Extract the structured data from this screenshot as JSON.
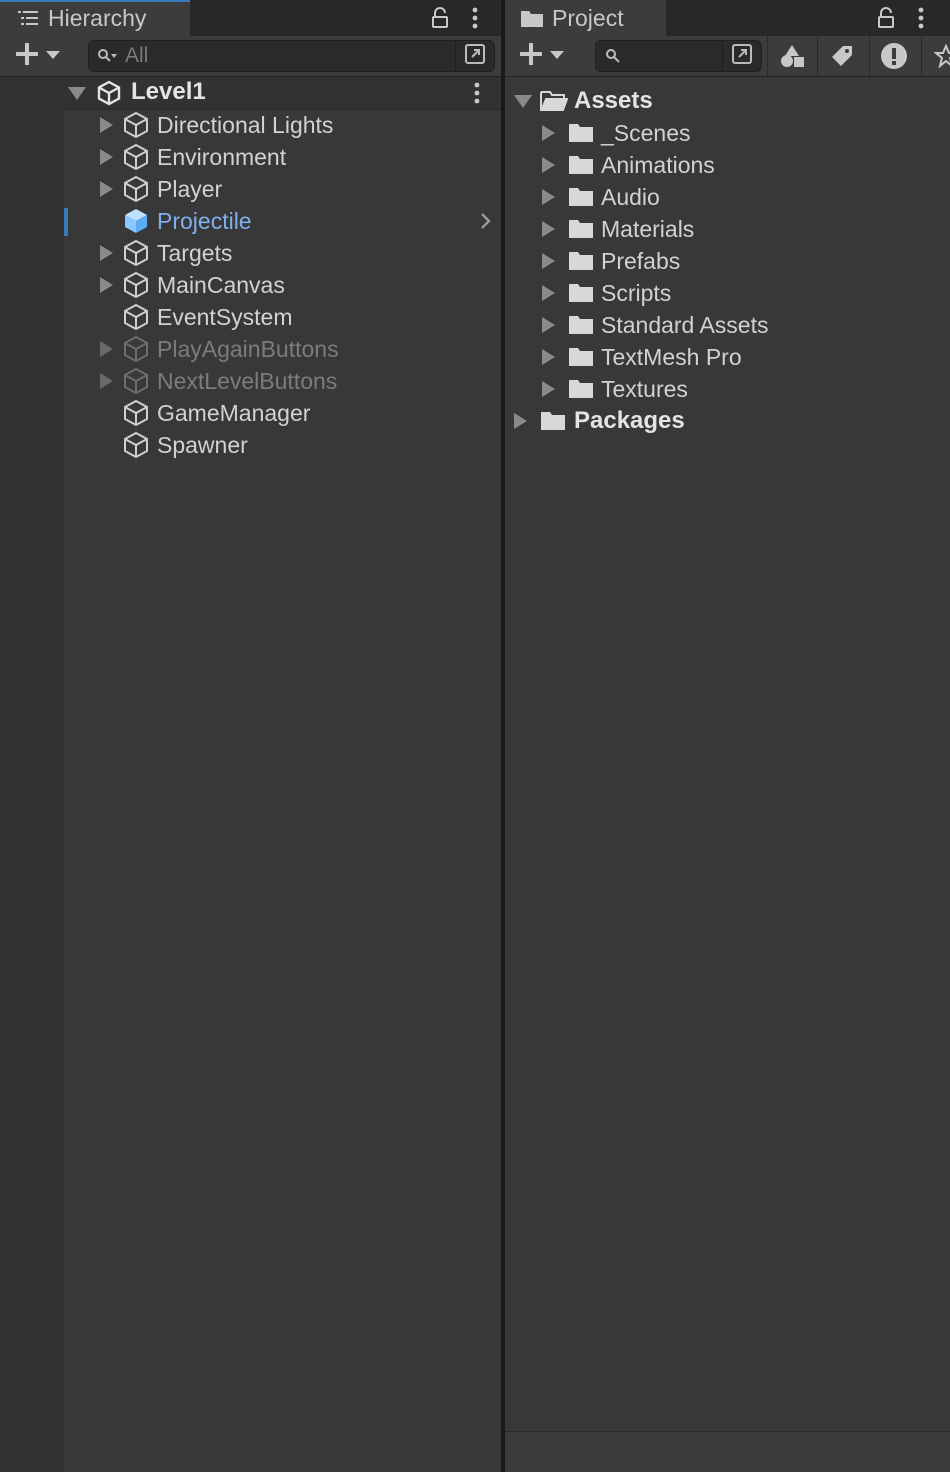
{
  "hierarchy": {
    "tab_label": "Hierarchy",
    "tab_icon": "list-icon",
    "search_placeholder": "All",
    "scene": {
      "name": "Level1",
      "icon": "unity-scene-icon",
      "expanded": true
    },
    "items": [
      {
        "name": "Directional Lights",
        "has_children": true,
        "state": "normal"
      },
      {
        "name": "Environment",
        "has_children": true,
        "state": "normal"
      },
      {
        "name": "Player",
        "has_children": true,
        "state": "normal"
      },
      {
        "name": "Projectile",
        "has_children": false,
        "state": "selected"
      },
      {
        "name": "Targets",
        "has_children": true,
        "state": "normal"
      },
      {
        "name": "MainCanvas",
        "has_children": true,
        "state": "normal"
      },
      {
        "name": "EventSystem",
        "has_children": false,
        "state": "normal"
      },
      {
        "name": "PlayAgainButtons",
        "has_children": true,
        "state": "disabled"
      },
      {
        "name": "NextLevelButtons",
        "has_children": true,
        "state": "disabled"
      },
      {
        "name": "GameManager",
        "has_children": false,
        "state": "normal"
      },
      {
        "name": "Spawner",
        "has_children": false,
        "state": "normal"
      }
    ]
  },
  "project": {
    "tab_label": "Project",
    "tab_icon": "folder-icon",
    "search_placeholder": "",
    "toolbar_icons": [
      "search-by-type-icon",
      "search-by-label-icon",
      "warning-icon",
      "favorite-icon"
    ],
    "assets": {
      "name": "Assets",
      "expanded": true,
      "children": [
        "_Scenes",
        "Animations",
        "Audio",
        "Materials",
        "Prefabs",
        "Scripts",
        "Standard Assets",
        "TextMesh Pro",
        "Textures"
      ]
    },
    "packages": {
      "name": "Packages",
      "expanded": false
    }
  },
  "colors": {
    "accent": "#3a79bb",
    "selected_text": "#7fb0ee",
    "panel_bg": "#383838",
    "text": "#d2d2d2",
    "disabled_text": "#7c7c7c"
  }
}
